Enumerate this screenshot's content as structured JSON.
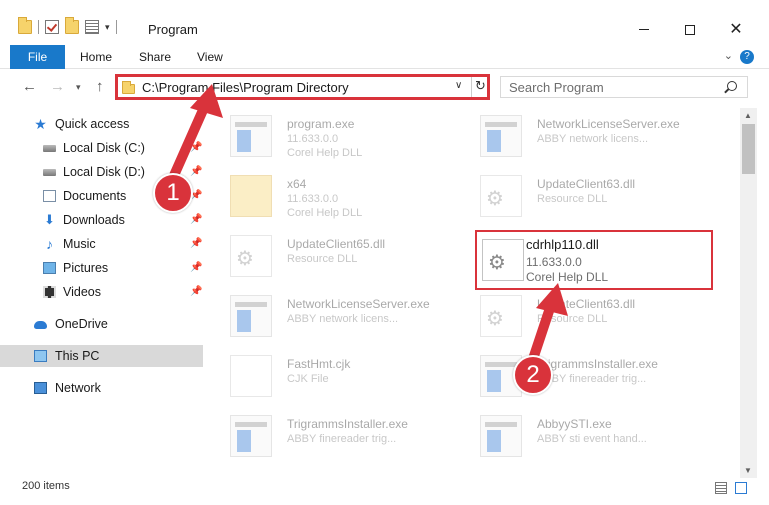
{
  "window": {
    "title": "Program",
    "colors": {
      "accent": "#1979ca",
      "annotation": "#d9333b"
    }
  },
  "ribbon": {
    "tabs": [
      "File",
      "Home",
      "Share",
      "View"
    ]
  },
  "address": {
    "path": "C:\\Program Files\\Program Directory"
  },
  "search": {
    "placeholder": "Search Program"
  },
  "sidebar": {
    "items": [
      {
        "label": "Quick access",
        "icon": "star-icon"
      },
      {
        "label": "Local Disk (C:)",
        "icon": "disk-icon",
        "pinned": true
      },
      {
        "label": "Local Disk (D:)",
        "icon": "disk-icon",
        "pinned": true
      },
      {
        "label": "Documents",
        "icon": "documents-icon",
        "pinned": true
      },
      {
        "label": "Downloads",
        "icon": "downloads-icon",
        "pinned": true
      },
      {
        "label": "Music",
        "icon": "music-icon",
        "pinned": true
      },
      {
        "label": "Pictures",
        "icon": "pictures-icon",
        "pinned": true
      },
      {
        "label": "Videos",
        "icon": "videos-icon",
        "pinned": true
      },
      {
        "label": "OneDrive",
        "icon": "onedrive-icon"
      },
      {
        "label": "This PC",
        "icon": "pc-icon",
        "selected": true
      },
      {
        "label": "Network",
        "icon": "network-icon"
      }
    ]
  },
  "files": [
    {
      "name": "program.exe",
      "version": "11.633.0.0",
      "description": "Corel Help DLL",
      "icon": "exe-icon"
    },
    {
      "name": "NetworkLicenseServer.exe",
      "version": "",
      "description": "ABBY network licens...",
      "icon": "exe-icon"
    },
    {
      "name": "x64",
      "version": "11.633.0.0",
      "description": "Corel Help DLL",
      "icon": "folder-icon"
    },
    {
      "name": "UpdateClient63.dll",
      "version": "",
      "description": "Resource DLL",
      "icon": "dll-icon"
    },
    {
      "name": "UpdateClient65.dll",
      "version": "",
      "description": "Resource DLL",
      "icon": "dll-icon"
    },
    {
      "name": "cdrhlp110.dll",
      "version": "11.633.0.0",
      "description": "Corel Help DLL",
      "icon": "dll-icon",
      "highlighted": true
    },
    {
      "name": "NetworkLicenseServer.exe",
      "version": "",
      "description": "ABBY network licens...",
      "icon": "exe-icon"
    },
    {
      "name": "UpdateClient63.dll",
      "version": "",
      "description": "Resource DLL",
      "icon": "dll-icon"
    },
    {
      "name": "FastHmt.cjk",
      "version": "",
      "description": "CJK File",
      "icon": "file-icon"
    },
    {
      "name": "TrigrammsInstaller.exe",
      "version": "",
      "description": "ABBY finereader trig...",
      "icon": "exe-icon"
    },
    {
      "name": "TrigrammsInstaller.exe",
      "version": "",
      "description": "ABBY finereader trig...",
      "icon": "exe-icon"
    },
    {
      "name": "AbbyySTI.exe",
      "version": "",
      "description": "ABBY sti event hand...",
      "icon": "exe-icon"
    }
  ],
  "statusbar": {
    "item_count": "200 items"
  },
  "annotations": {
    "step1": "1",
    "step2": "2"
  }
}
